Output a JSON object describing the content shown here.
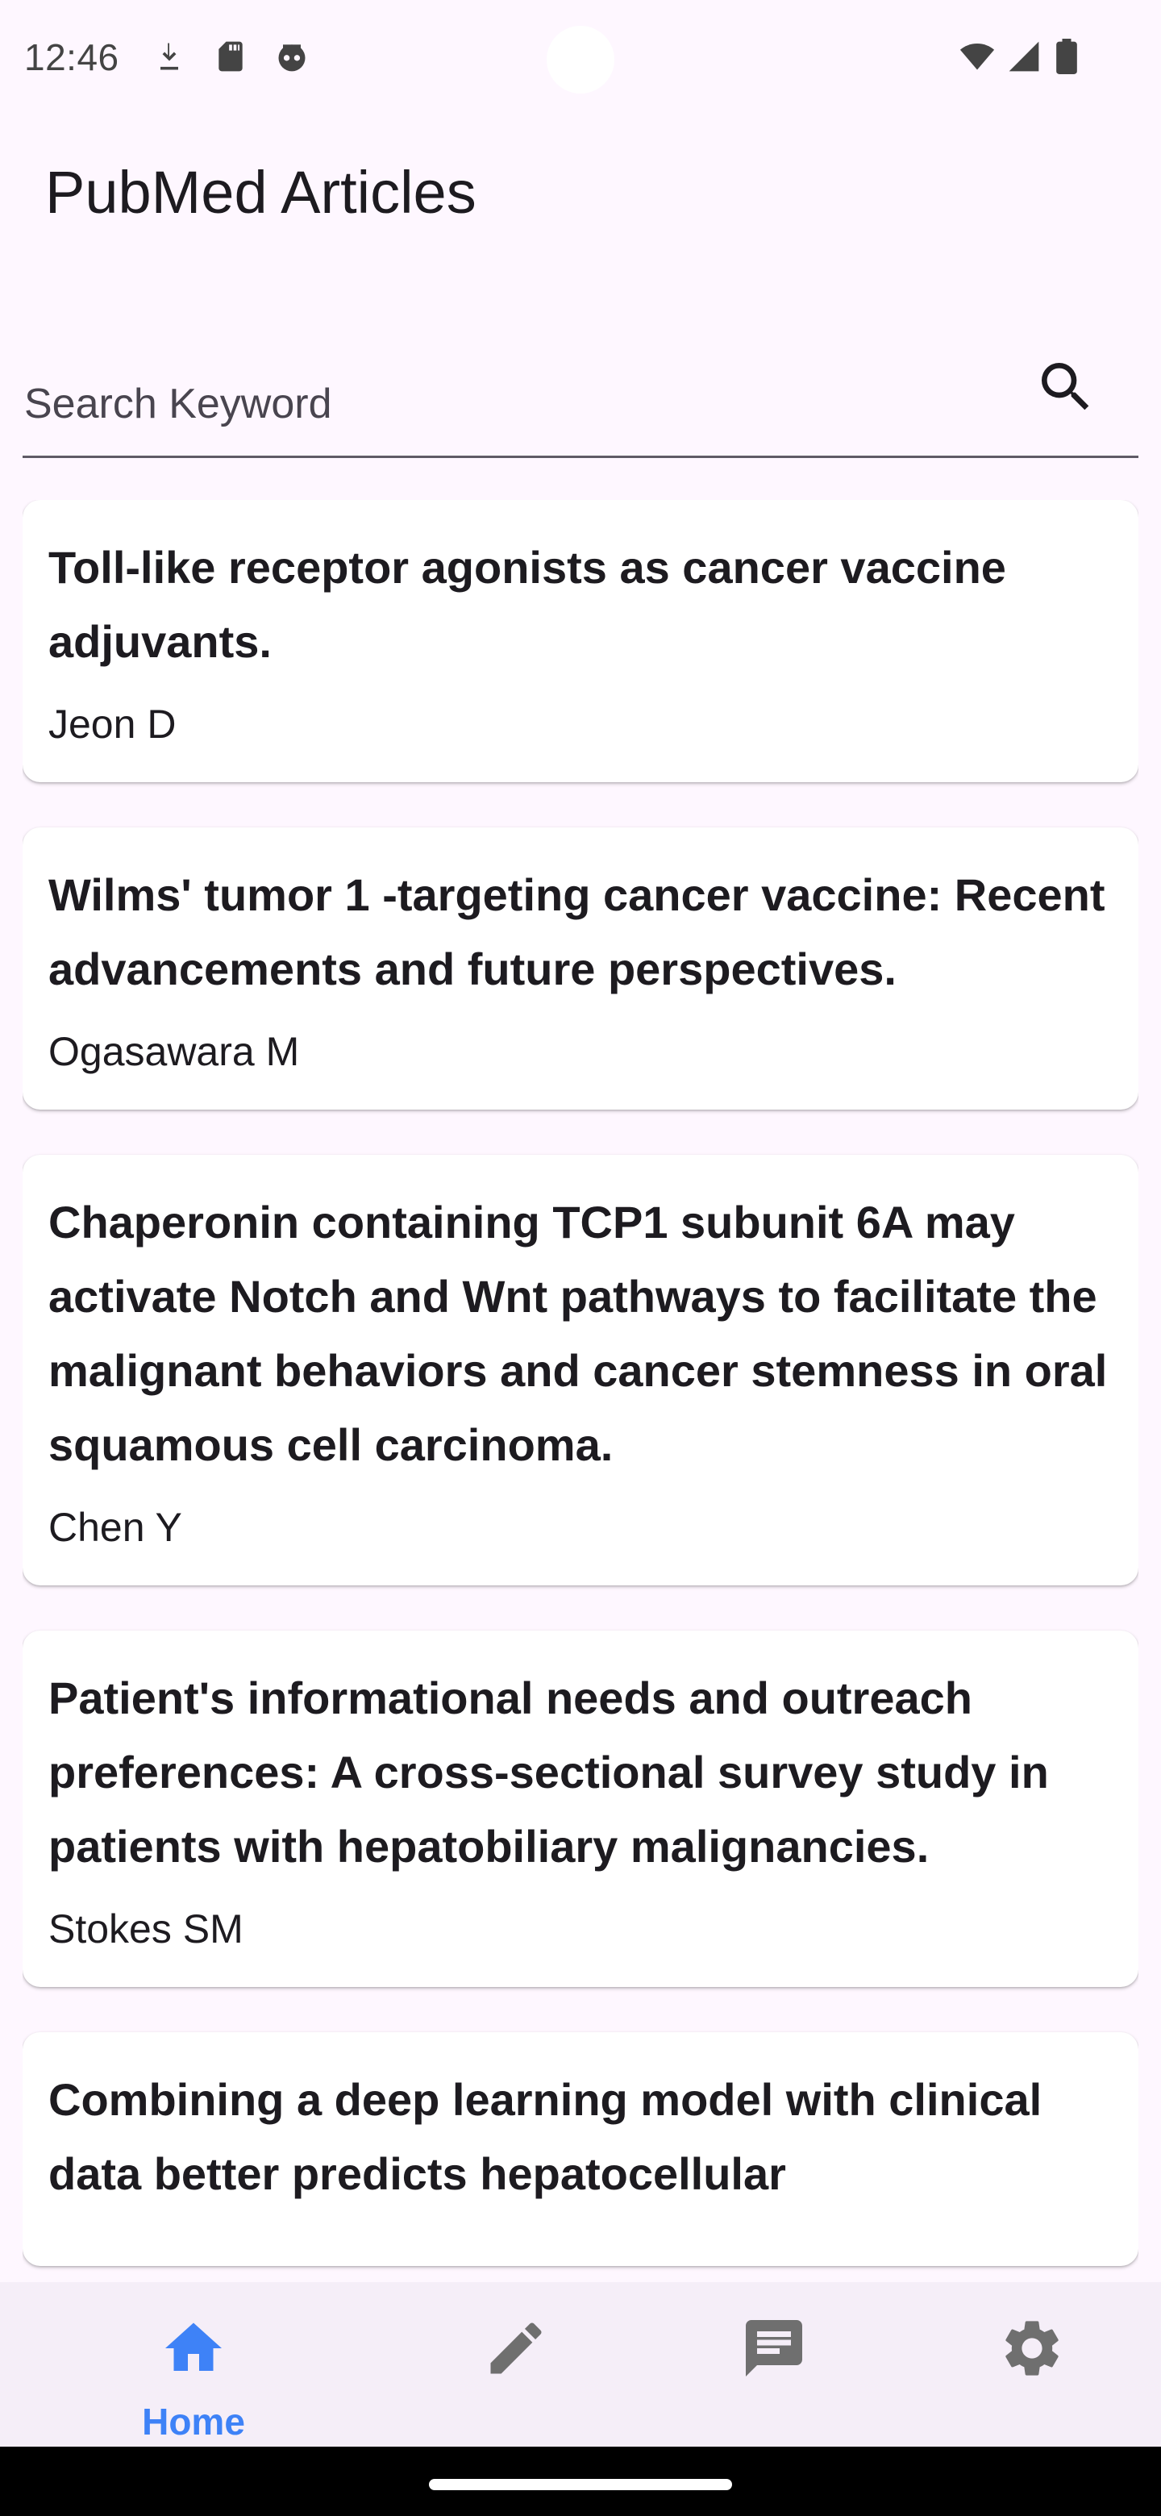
{
  "status_bar": {
    "time": "12:46",
    "left_icons": [
      "download-icon",
      "sd-card-icon",
      "robot-face-icon"
    ],
    "right_icons": [
      "wifi-icon",
      "cell-signal-icon",
      "battery-icon"
    ]
  },
  "app_bar": {
    "title": "PubMed Articles"
  },
  "search": {
    "placeholder": "Search Keyword",
    "value": "",
    "icon": "search-icon"
  },
  "articles": [
    {
      "title": "Toll-like receptor agonists as cancer vaccine adjuvants.",
      "author": "Jeon D"
    },
    {
      "title": "Wilms' tumor 1 -targeting cancer vaccine: Recent advancements and future perspectives.",
      "author": "Ogasawara M"
    },
    {
      "title": "Chaperonin containing TCP1 subunit 6A may activate Notch and Wnt pathways to facilitate the malignant behaviors and cancer stemness in oral squamous cell carcinoma.",
      "author": "Chen Y"
    },
    {
      "title": "Patient's informational needs and outreach preferences: A cross-sectional survey study in patients with hepatobiliary malignancies.",
      "author": "Stokes SM"
    },
    {
      "title": "Combining a deep learning model with clinical data better predicts hepatocellular",
      "author": ""
    }
  ],
  "bottom_nav": {
    "items": [
      {
        "label": "Home",
        "icon": "home-icon",
        "selected": true
      },
      {
        "label": "",
        "icon": "edit-icon",
        "selected": false
      },
      {
        "label": "",
        "icon": "chat-icon",
        "selected": false
      },
      {
        "label": "",
        "icon": "settings-icon",
        "selected": false
      }
    ]
  },
  "colors": {
    "background": "#FEF7FF",
    "nav_background": "#F5EEF8",
    "selected_accent": "#3E82F7",
    "unselected_icon": "#6F6F6F",
    "text": "#1D1B20"
  }
}
